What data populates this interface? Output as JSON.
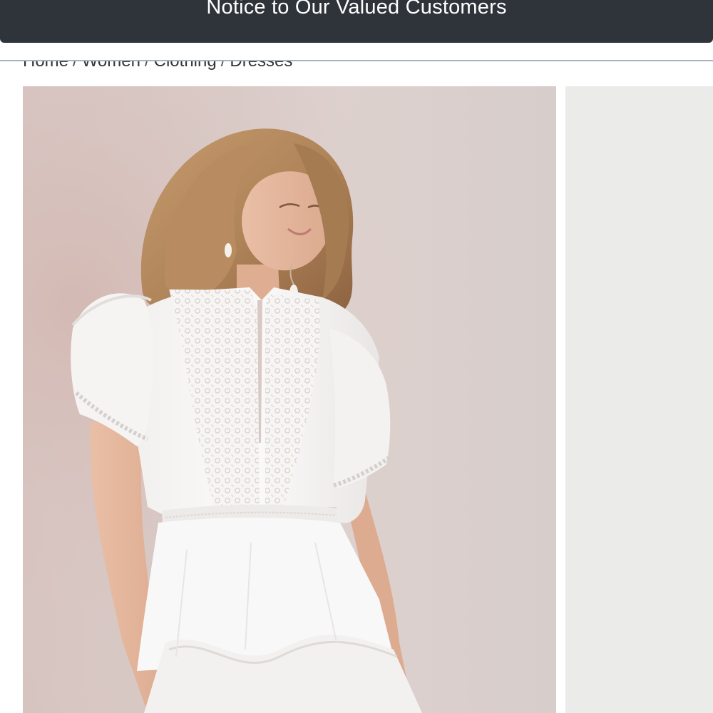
{
  "notice": {
    "text": "Notice to Our Valued Customers"
  },
  "breadcrumb": {
    "items": [
      "Home",
      "Women",
      "Clothing",
      "Dresses"
    ],
    "separator": "/"
  },
  "gallery": {
    "main_image": "model-in-white-lace-ruffle-dress",
    "secondary_image": "product-image-partial"
  },
  "colors": {
    "banner_bg": "#2f343b",
    "divider": "#a9b0c0",
    "photo_bg": "#d9cac6"
  }
}
